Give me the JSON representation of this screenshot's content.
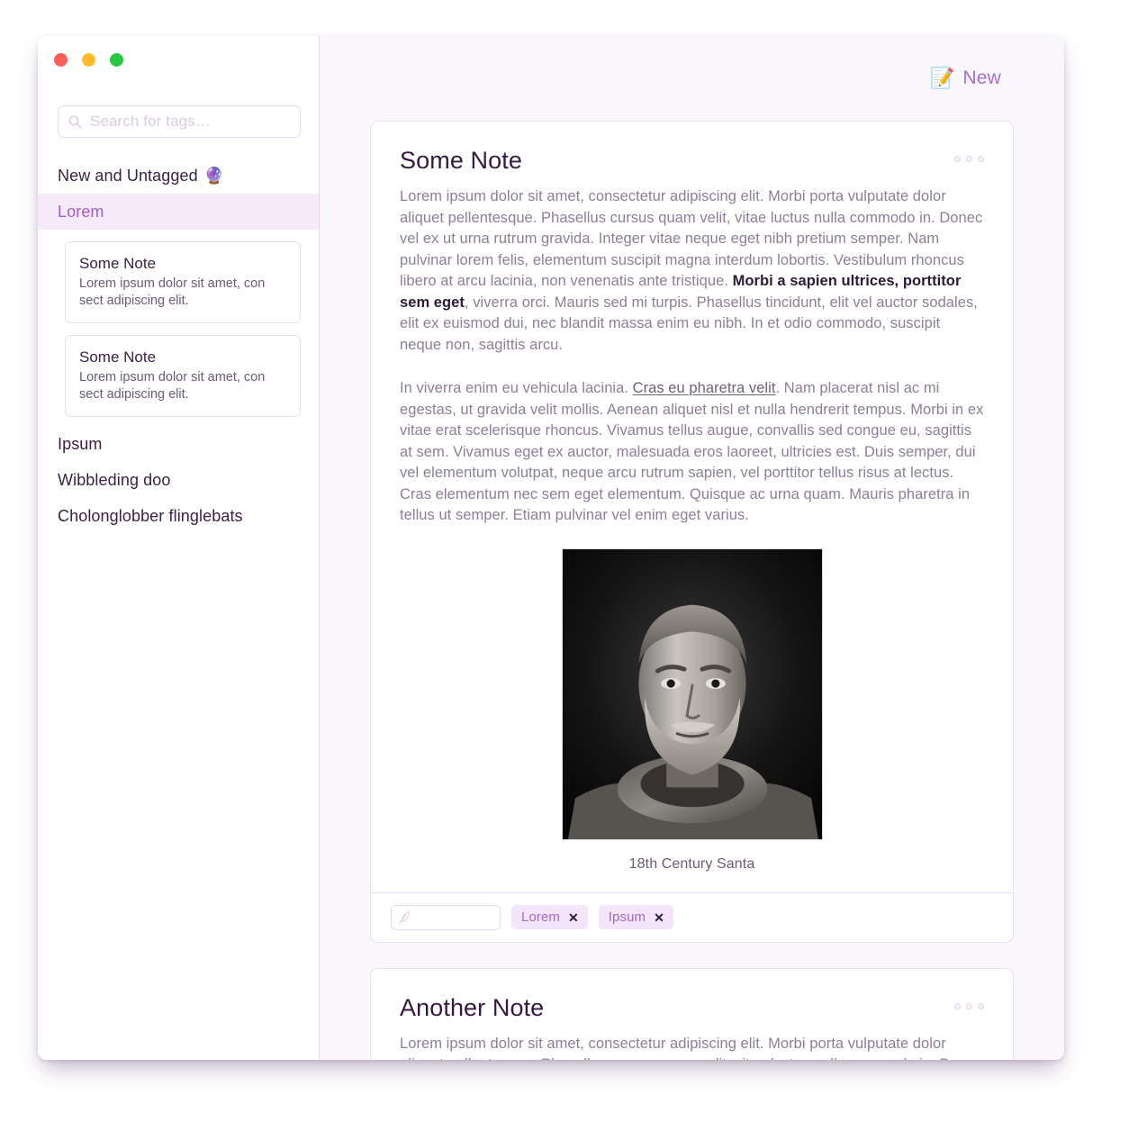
{
  "window": {
    "traffic_lights": [
      {
        "name": "close",
        "color": "#ff5f57"
      },
      {
        "name": "minimize",
        "color": "#ffbd2e"
      },
      {
        "name": "zoom",
        "color": "#28c840"
      }
    ]
  },
  "sidebar": {
    "search": {
      "placeholder": "Search for tags…",
      "value": "",
      "icon": "search-icon"
    },
    "tags": [
      {
        "label": "New and Untagged",
        "emoji": "🔮",
        "selected": false
      },
      {
        "label": "Lorem",
        "emoji": "",
        "selected": true
      },
      {
        "label": "Ipsum",
        "emoji": "",
        "selected": false
      },
      {
        "label": "Wibbleding doo",
        "emoji": "",
        "selected": false
      },
      {
        "label": "Cholonglobber flinglebats",
        "emoji": "",
        "selected": false
      }
    ],
    "note_stubs": [
      {
        "title": "Some Note",
        "excerpt": "Lorem ipsum dolor sit amet, con sect adipiscing elit."
      },
      {
        "title": "Some Note",
        "excerpt": "Lorem ipsum dolor sit amet, con sect adipiscing elit."
      }
    ]
  },
  "main": {
    "toolbar": {
      "new_label": "New",
      "new_icon": "📝"
    },
    "notes": [
      {
        "title": "Some Note",
        "paragraph1_pre": "Lorem ipsum dolor sit amet, consectetur adipiscing elit. Morbi porta vulputate dolor aliquet pellentesque. Phasellus cursus quam velit, vitae luctus nulla commodo in. Donec vel ex ut urna rutrum gravida. Integer vitae neque eget nibh pretium semper. Nam pulvinar lorem felis, elementum suscipit magna interdum lobortis. Vestibulum rhoncus libero at arcu lacinia, non venenatis ante tristique. ",
        "paragraph1_bold": "Morbi a sapien ultrices, porttitor sem eget",
        "paragraph1_post": ", viverra orci. Mauris sed mi turpis. Phasellus tincidunt, elit vel auctor sodales, elit ex euismod dui, nec blandit massa enim eu nibh. In et odio commodo, suscipit neque non, sagittis arcu.",
        "paragraph2_pre": "In viverra enim eu vehicula lacinia. ",
        "paragraph2_link": "Cras eu pharetra velit",
        "paragraph2_post": ". Nam placerat nisl ac mi egestas, ut gravida velit mollis. Aenean aliquet nisl et nulla hendrerit tempus. Morbi in ex vitae erat scelerisque rhoncus. Vivamus tellus augue, convallis sed congue eu, sagittis at sem. Vivamus eget ex auctor, malesuada eros laoreet, ultricies est. Duis semper, dui vel elementum volutpat, neque arcu rutrum sapien, vel porttitor tellus risus at lectus. Cras elementum nec sem eget elementum. Quisque ac urna quam. Mauris pharetra in tellus ut semper. Etiam pulvinar vel enim eget varius.",
        "image_caption": "18th Century Santa",
        "image_alt": "black and white portrait photograph of a bearded man in a turtleneck sweater",
        "tag_input_placeholder": "",
        "tag_input_value": "",
        "tags": [
          {
            "label": "Lorem",
            "remove": "✕"
          },
          {
            "label": "Ipsum",
            "remove": "✕"
          }
        ]
      },
      {
        "title": "Another Note",
        "paragraph1": "Lorem ipsum dolor sit amet, consectetur adipiscing elit. Morbi porta vulputate dolor aliquet pellentesque. Phasellus cursus quam velit, vitae luctus nulla commodo in. Donec vel ex ut urna rutrum gravida. Integer vitae neque eget nibh pretium semper."
      }
    ]
  },
  "colors": {
    "accent": "#a870c8",
    "selected_bg": "#f5e9fa",
    "border": "#ecdef4",
    "main_bg": "#faf7fc",
    "text_dark": "#341a40",
    "text_muted": "#8d7e98"
  }
}
